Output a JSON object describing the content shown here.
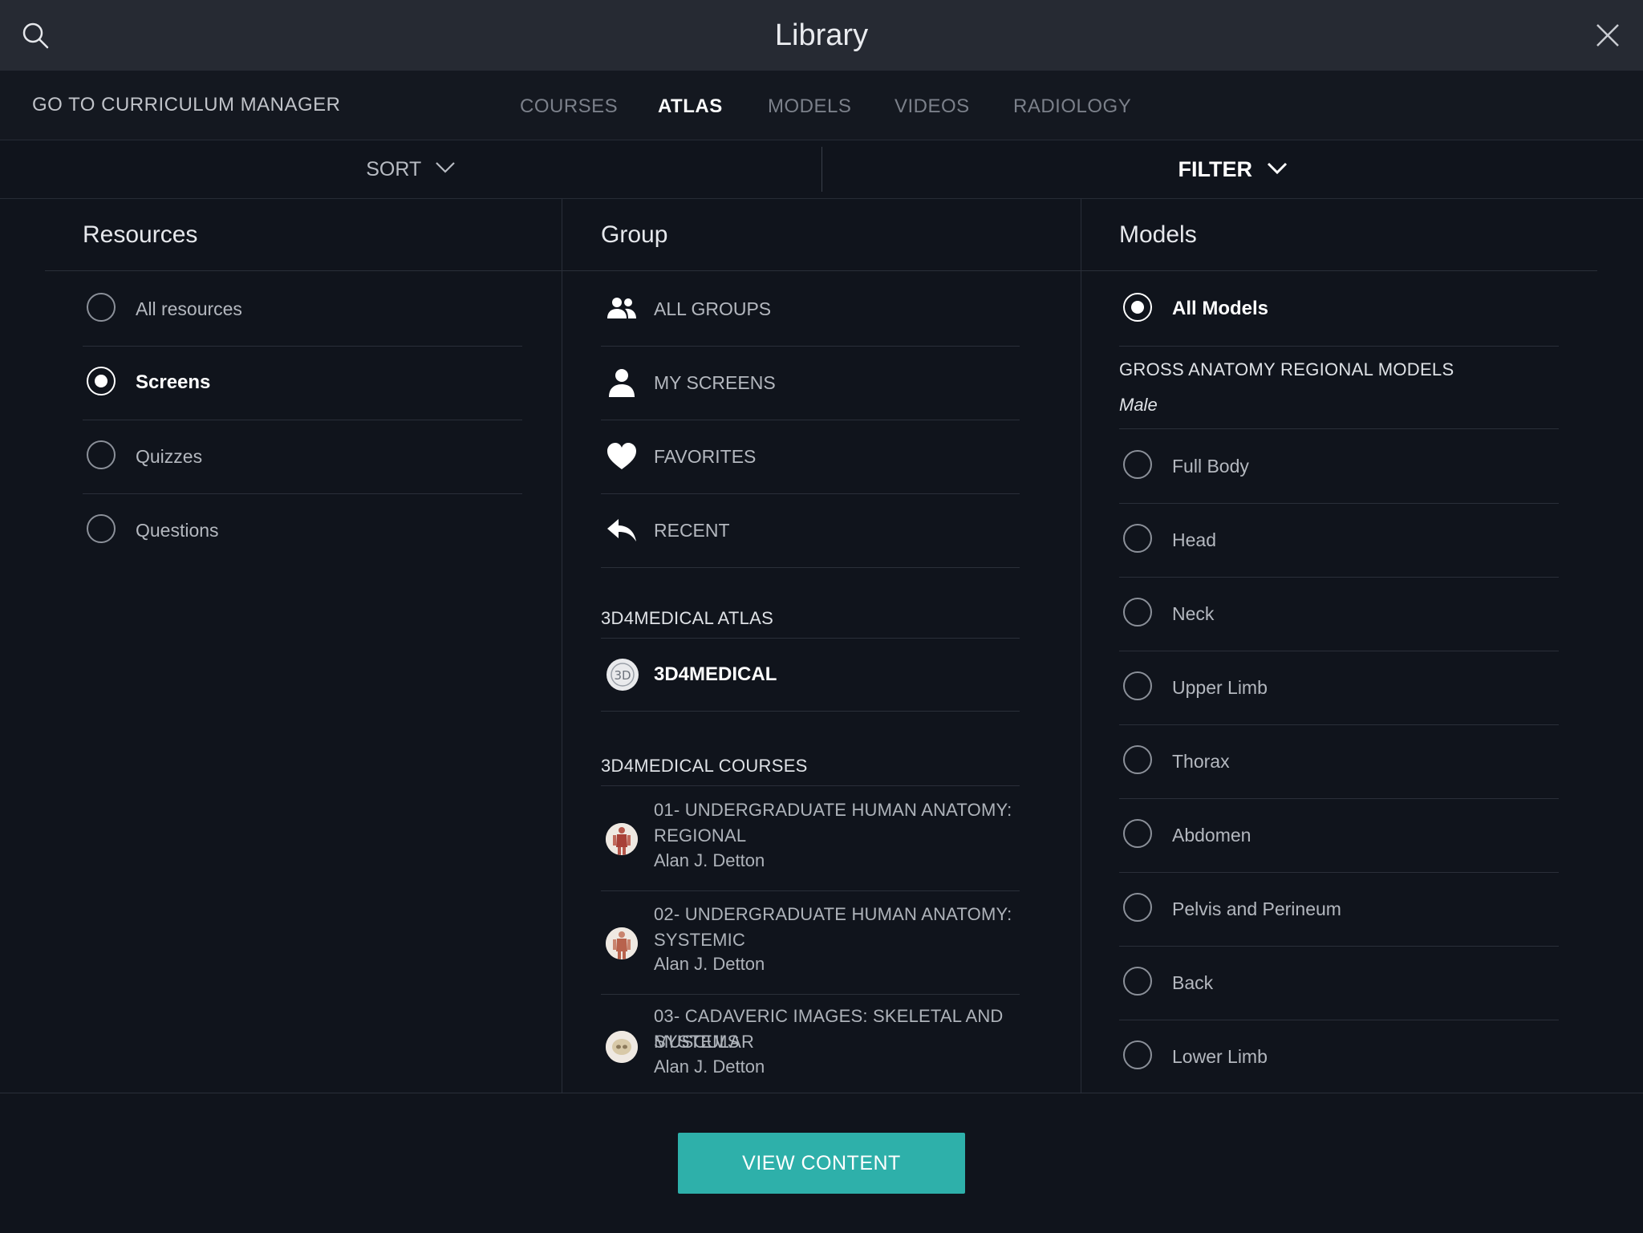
{
  "topbar": {
    "title": "Library"
  },
  "navbar": {
    "curriculum_link": "GO TO CURRICULUM MANAGER",
    "tabs": [
      {
        "label": "COURSES",
        "active": false
      },
      {
        "label": "ATLAS",
        "active": true
      },
      {
        "label": "MODELS",
        "active": false
      },
      {
        "label": "VIDEOS",
        "active": false
      },
      {
        "label": "RADIOLOGY",
        "active": false
      }
    ]
  },
  "sortbar": {
    "sort_label": "SORT",
    "filter_label": "FILTER"
  },
  "resources": {
    "title": "Resources",
    "items": [
      {
        "label": "All resources",
        "selected": false
      },
      {
        "label": "Screens",
        "selected": true
      },
      {
        "label": "Quizzes",
        "selected": false
      },
      {
        "label": "Questions",
        "selected": false
      }
    ]
  },
  "group": {
    "title": "Group",
    "items": [
      {
        "label": "ALL GROUPS",
        "icon": "people-icon"
      },
      {
        "label": "MY SCREENS",
        "icon": "person-icon"
      },
      {
        "label": "FAVORITES",
        "icon": "heart-icon"
      },
      {
        "label": "RECENT",
        "icon": "reply-icon"
      }
    ],
    "atlas_section": "3D4MEDICAL ATLAS",
    "atlas_item": "3D4MEDICAL",
    "courses_section": "3D4MEDICAL COURSES",
    "courses": [
      {
        "title_line1": "01- UNDERGRADUATE HUMAN ANATOMY:",
        "title_line2": "REGIONAL",
        "author": "Alan J. Detton"
      },
      {
        "title_line1": "02- UNDERGRADUATE HUMAN ANATOMY:",
        "title_line2": "SYSTEMIC",
        "author": "Alan J. Detton"
      },
      {
        "title_line1": "03- CADAVERIC IMAGES: SKELETAL AND MUSCULAR",
        "title_line2": "SYSTEMS",
        "author": "Alan J. Detton"
      }
    ]
  },
  "models": {
    "title": "Models",
    "all_models": "All Models",
    "section": "GROSS ANATOMY REGIONAL MODELS",
    "subsection": "Male",
    "items": [
      {
        "label": "Full Body",
        "selected": false
      },
      {
        "label": "Head",
        "selected": false
      },
      {
        "label": "Neck",
        "selected": false
      },
      {
        "label": "Upper Limb",
        "selected": false
      },
      {
        "label": "Thorax",
        "selected": false
      },
      {
        "label": "Abdomen",
        "selected": false
      },
      {
        "label": "Pelvis and Perineum",
        "selected": false
      },
      {
        "label": "Back",
        "selected": false
      },
      {
        "label": "Lower Limb",
        "selected": false
      }
    ]
  },
  "footer": {
    "view_button": "VIEW CONTENT"
  },
  "colors": {
    "accent": "#2eb0aa",
    "background": "#10141c",
    "topbar": "#262a33"
  }
}
